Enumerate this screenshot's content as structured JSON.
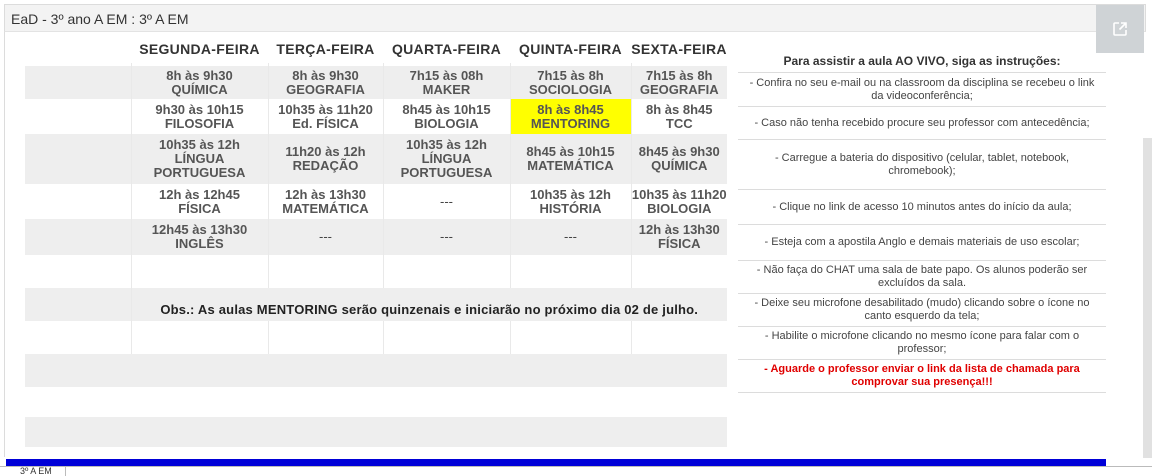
{
  "window": {
    "title": "EaD - 3º ano A EM : 3º A EM",
    "sheet_tab": "3º A EM"
  },
  "schedule": {
    "days": [
      "SEGUNDA-FEIRA",
      "TERÇA-FEIRA",
      "QUARTA-FEIRA",
      "QUINTA-FEIRA",
      "SEXTA-FEIRA"
    ],
    "rows": [
      [
        "8h às 9h30\nQUÍMICA",
        "8h às 9h30\nGEOGRAFIA",
        "7h15 às 08h\nMAKER",
        "7h15 às 8h\nSOCIOLOGIA",
        "7h15 às 8h\nGEOGRAFIA"
      ],
      [
        "9h30 às 10h15\nFILOSOFIA",
        "10h35 às 11h20\nEd. FÍSICA",
        "8h45 às 10h15\nBIOLOGIA",
        "8h às 8h45\nMENTORING",
        "8h às 8h45\nTCC"
      ],
      [
        "10h35 às 12h\nLÍNGUA\nPORTUGUESA",
        "11h20 às 12h\nREDAÇÃO",
        "10h35 às 12h\nLÍNGUA\nPORTUGUESA",
        "8h45 às 10h15\nMATEMÁTICA",
        "8h45 às 9h30\nQUÍMICA"
      ],
      [
        "12h às 12h45\nFÍSICA",
        "12h às 13h30\nMATEMÁTICA",
        "---",
        "10h35 às 12h\nHISTÓRIA",
        "10h35 às 11h20\nBIOLOGIA"
      ],
      [
        "12h45 às 13h30\nINGLÊS",
        "---",
        "---",
        "---",
        "12h às 13h30\nFÍSICA"
      ]
    ],
    "highlight_color": "#ffff00",
    "obs": "Obs.: As aulas MENTORING serão quinzenais e iniciarão no próximo dia 02 de julho."
  },
  "instructions": {
    "heading": "Para assistir a aula AO VIVO, siga as instruções:",
    "items": [
      "- Confira no seu e-mail ou na classroom da disciplina se recebeu o link da videoconferência;",
      "- Caso não tenha recebido procure seu professor com antecedência;",
      "- Carregue a bateria do dispositivo (celular, tablet, notebook, chromebook);",
      "- Clique no link de acesso 10 minutos antes do início da aula;",
      "- Esteja com a apostila Anglo e demais materiais de uso escolar;",
      "- Não faça do CHAT uma sala de bate papo. Os alunos poderão ser excluídos da sala.",
      "- Deixe seu microfone desabilitado (mudo) clicando sobre o ícone no canto esquerdo da tela;",
      "- Habilite o microfone clicando no mesmo ícone para falar com o professor;",
      "- Aguarde o professor enviar o link da lista de chamada para comprovar sua presença!!!"
    ],
    "alert_color": "#e00000"
  },
  "icons": {
    "open_external": "open-in-new-icon"
  }
}
